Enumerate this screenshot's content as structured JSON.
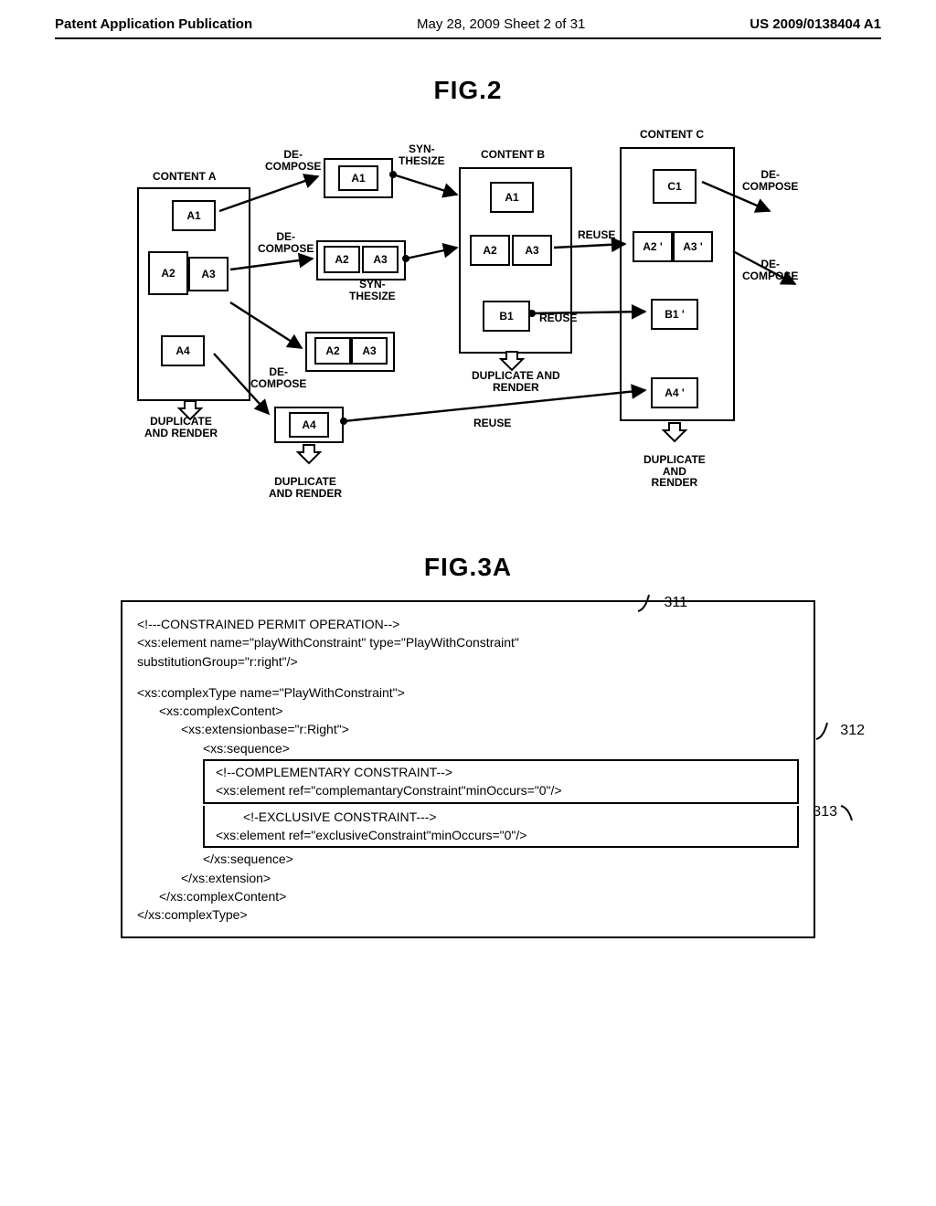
{
  "header": {
    "left": "Patent Application Publication",
    "mid": "May 28, 2009  Sheet 2 of 31",
    "right": "US 2009/0138404 A1"
  },
  "fig2": {
    "title": "FIG.2",
    "contentA": "CONTENT A",
    "contentB": "CONTENT B",
    "contentC": "CONTENT C",
    "decompose": "DE-\nCOMPOSE",
    "synthesize": "SYN-\nTHESIZE",
    "reuse": "REUSE",
    "dupRender": "DUPLICATE\nAND RENDER",
    "dupAndRender": "DUPLICATE AND\nRENDER",
    "dupAndRenderStack": "DUPLICATE\nAND\nRENDER",
    "cells": {
      "A1": "A1",
      "A2": "A2",
      "A3": "A3",
      "A4": "A4",
      "B1": "B1",
      "C1": "C1",
      "A1p": "A1",
      "A2p": "A2 '",
      "A3p": "A3 '",
      "A4p": "A4 '",
      "B1p": "B1 '"
    }
  },
  "fig3a": {
    "title": "FIG.3A",
    "callouts": {
      "c311": "311",
      "c312": "312",
      "c313": "313"
    },
    "lines": {
      "l1": "<!---CONSTRAINED PERMIT OPERATION-->",
      "l2": "<xs:element name=\"playWithConstraint\"  type=\"PlayWithConstraint\"",
      "l3": "substitutionGroup=\"r:right\"/>",
      "l4": "<xs:complexType name=\"PlayWithConstraint\">",
      "l5": "<xs:complexContent>",
      "l6": "<xs:extensionbase=\"r:Right\">",
      "l7": "<xs:sequence>",
      "l8": "<!--COMPLEMENTARY CONSTRAINT-->",
      "l9": "<xs:element ref=\"complemantaryConstraint\"minOccurs=\"0\"/>",
      "l10": "<!-EXCLUSIVE CONSTRAINT--->",
      "l11": "<xs:element ref=\"exclusiveConstraint\"minOccurs=\"0\"/>",
      "l12": "</xs:sequence>",
      "l13": "</xs:extension>",
      "l14": "</xs:complexContent>",
      "l15": "</xs:complexType>"
    }
  }
}
